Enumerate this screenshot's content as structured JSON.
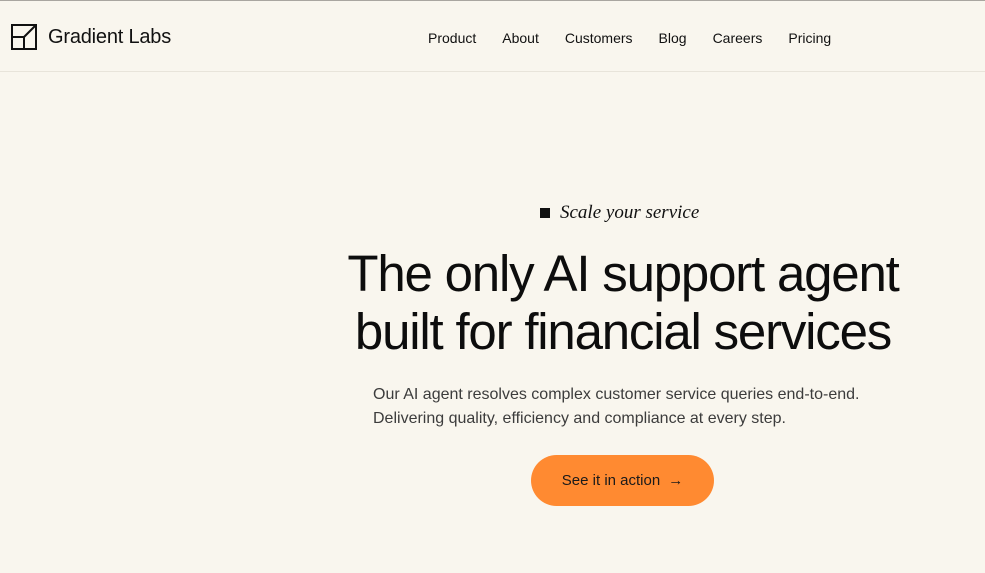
{
  "header": {
    "brand": "Gradient Labs",
    "logo_icon": "gradient-labs-logo-icon",
    "nav": [
      {
        "label": "Product"
      },
      {
        "label": "About"
      },
      {
        "label": "Customers"
      },
      {
        "label": "Blog"
      },
      {
        "label": "Careers"
      },
      {
        "label": "Pricing"
      }
    ]
  },
  "hero": {
    "eyebrow": "Scale your service",
    "headline": "The only AI support agent built for financial services",
    "subtitle": "Our AI agent resolves complex customer service queries end-to-end. Delivering quality, efficiency and compliance at every step.",
    "cta_label": "See it in action",
    "cta_icon": "arrow-right-icon",
    "cta_arrow": "→"
  },
  "colors": {
    "background": "#f9f6ee",
    "accent": "#ff8a31",
    "text": "#111111"
  }
}
